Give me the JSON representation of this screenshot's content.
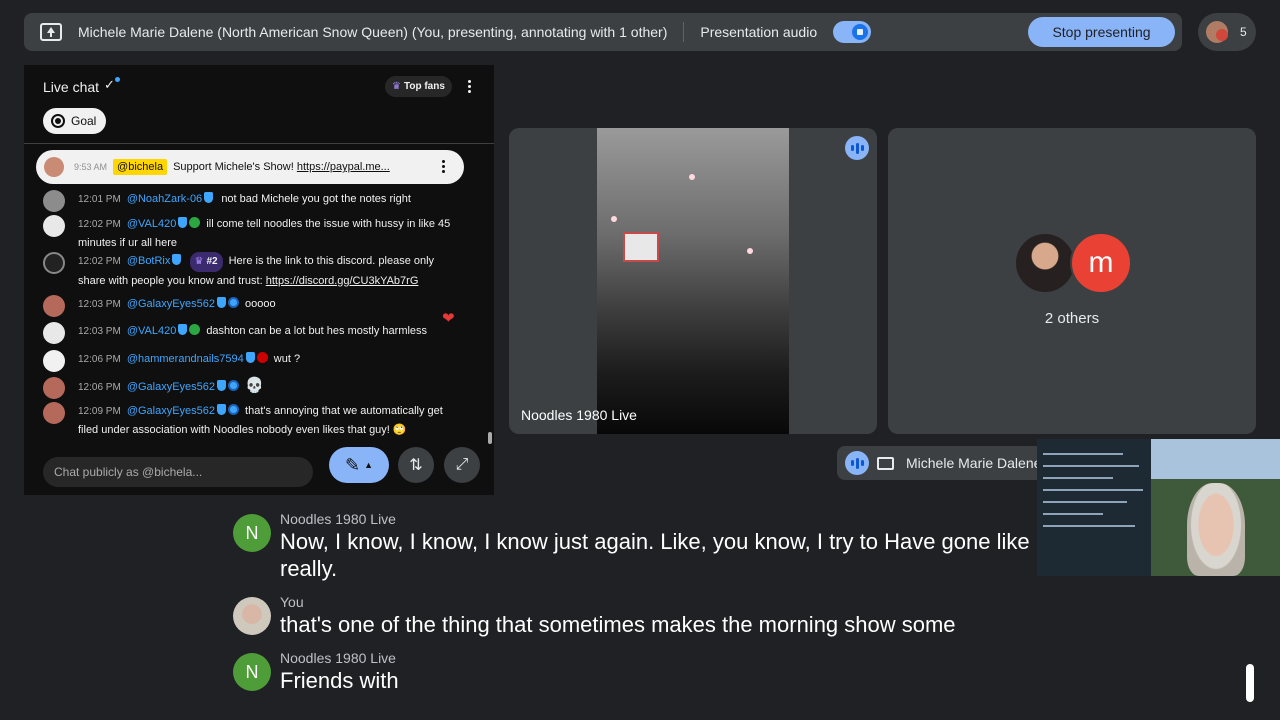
{
  "topbar": {
    "title": "Michele Marie Dalene (North American Snow Queen) (You, presenting, annotating with 1 other)",
    "audio_label": "Presentation audio",
    "stop_label": "Stop presenting",
    "participant_count": "5",
    "audio_on": true
  },
  "chat": {
    "title": "Live chat",
    "top_fans": "Top fans",
    "goal": "Goal",
    "pinned": {
      "time": "9:53 AM",
      "author": "@bichela",
      "text": "Support Michele's Show!",
      "link": "https://paypal.me..."
    },
    "messages": [
      {
        "time": "12:01 PM",
        "author": "@NoahZark-06",
        "text": "not bad Michele you got the notes right"
      },
      {
        "time": "12:02 PM",
        "author": "@VAL420",
        "text": "ill come tell noodles the issue with hussy in like 45 minutes if ur all here"
      },
      {
        "time": "12:02 PM",
        "author": "@BotRix",
        "rank": "#2",
        "text": "Here is the link to this discord. please only share with people you know and trust:",
        "link": "https://discord.gg/CU3kYAb7rG"
      },
      {
        "time": "12:03 PM",
        "author": "@GalaxyEyes562",
        "text": "ooooo"
      },
      {
        "time": "12:03 PM",
        "author": "@VAL420",
        "text": "dashton can be a lot but hes mostly harmless"
      },
      {
        "time": "12:06 PM",
        "author": "@hammerandnails7594",
        "text": "wut ?"
      },
      {
        "time": "12:06 PM",
        "author": "@GalaxyEyes562",
        "text": "💀"
      },
      {
        "time": "12:09 PM",
        "author": "@GalaxyEyes562",
        "text": "that's annoying that we automatically get filed under association with Noodles nobody even likes that guy! 🙄"
      }
    ],
    "input_placeholder": "Chat publicly as @bichela..."
  },
  "tiles": {
    "noodles_name": "Noodles 1980 Live",
    "others_label": "2 others",
    "others_initial": "m",
    "self_name": "Michele Marie Dalene"
  },
  "captions": [
    {
      "speaker": "Noodles 1980 Live",
      "initial": "N",
      "text": "Now, I know, I know, I know just again. Like, you know, I try to Have gone like really."
    },
    {
      "speaker": "You",
      "text": "that's one of the thing that sometimes makes the morning show some"
    },
    {
      "speaker": "Noodles 1980 Live",
      "initial": "N",
      "text": "Friends with"
    }
  ],
  "colors": {
    "accent": "#8ab4f8",
    "background": "#202124",
    "chat_bg": "#0f0f0f",
    "author_blue": "#3ea6ff",
    "caption_avatar_green": "#4f9d39"
  },
  "icons": [
    "present-screen-icon",
    "audio-toggle-icon",
    "participants-icon",
    "verified-check-icon",
    "more-vert-icon",
    "crown-icon",
    "goal-icon",
    "annotate-pen-icon",
    "swap-icon",
    "expand-icon",
    "speaking-indicator-icon",
    "camera-icon",
    "heart-icon"
  ]
}
